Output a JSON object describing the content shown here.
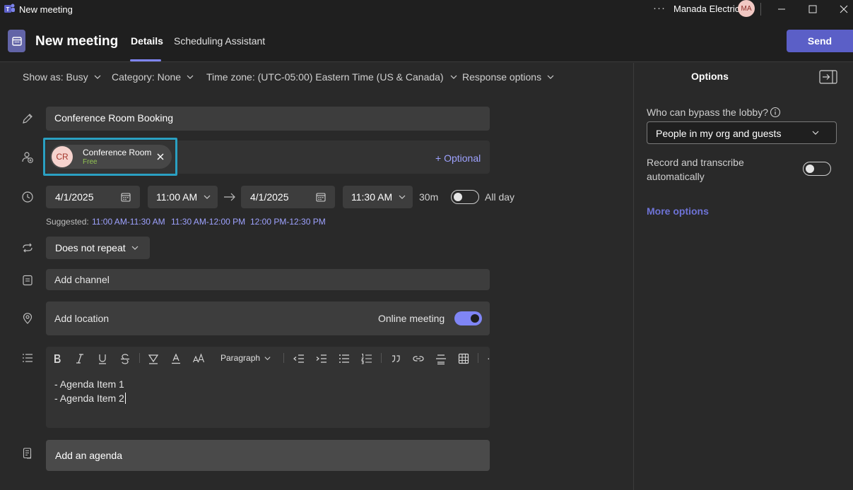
{
  "window": {
    "title": "New meeting",
    "more": "···",
    "org_name": "Manada Electric",
    "avatar_initials": "MA"
  },
  "header": {
    "title": "New meeting",
    "tabs": [
      {
        "label": "Details",
        "active": true
      },
      {
        "label": "Scheduling Assistant",
        "active": false
      }
    ],
    "send_label": "Send"
  },
  "options_bar": {
    "show_as": "Show as: Busy",
    "category": "Category: None",
    "time_zone": "Time zone: (UTC-05:00) Eastern Time (US & Canada)",
    "response": "Response options"
  },
  "form": {
    "title_value": "Conference Room Booking",
    "attendees": [
      {
        "initials": "CR",
        "name": "Conference Room",
        "status": "Free"
      }
    ],
    "optional_label": "+ Optional",
    "start_date": "4/1/2025",
    "start_time": "11:00 AM",
    "end_date": "4/1/2025",
    "end_time": "11:30 AM",
    "duration": "30m",
    "all_day_label": "All day",
    "all_day": false,
    "suggested_label": "Suggested:",
    "suggested_times": [
      "11:00 AM-11:30 AM",
      "11:30 AM-12:00 PM",
      "12:00 PM-12:30 PM"
    ],
    "repeat": "Does not repeat",
    "channel_placeholder": "Add channel",
    "location_placeholder": "Add location",
    "online_meeting_label": "Online meeting",
    "online_meeting": true,
    "editor_format": "Paragraph",
    "body_lines": [
      "- Agenda Item 1",
      "- Agenda Item 2"
    ],
    "agenda_label": "Add an agenda"
  },
  "options_panel": {
    "title": "Options",
    "lobby_label": "Who can bypass the lobby?",
    "lobby_value": "People in my org and guests",
    "record_label_1": "Record and transcribe",
    "record_label_2": "automatically",
    "record": false,
    "more_options": "More options"
  },
  "colors": {
    "accent": "#5b5fc7",
    "link": "#9ea2ff",
    "highlight": "#2aa0c2",
    "free_status": "#92c353"
  }
}
